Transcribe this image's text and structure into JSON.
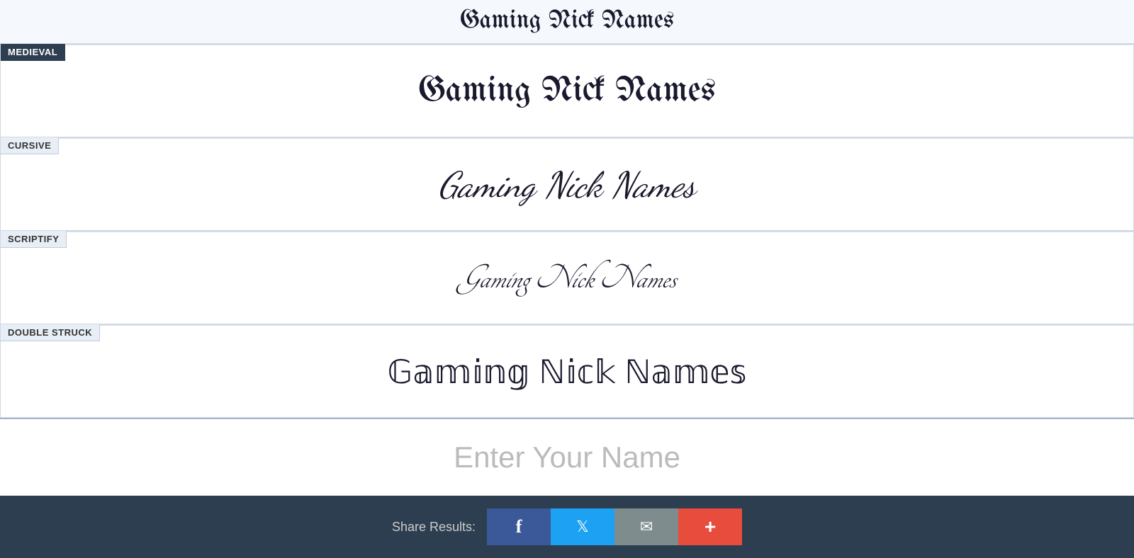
{
  "top": {
    "text": "Gaming Nick Names"
  },
  "sections": [
    {
      "id": "medieval",
      "label": "MEDIEVAL",
      "label_style": "dark",
      "text": "Gaming Nick Names",
      "font_class": "medieval-font"
    },
    {
      "id": "cursive",
      "label": "CURSIVE",
      "label_style": "light",
      "text": "Gaming Nick Names",
      "font_class": "cursive-font"
    },
    {
      "id": "scriptify",
      "label": "SCRIPTIFY",
      "label_style": "light",
      "text": "Gaming Nick Names",
      "font_class": "scriptify-font"
    },
    {
      "id": "double-struck",
      "label": "DOUBLE STRUCK",
      "label_style": "light",
      "text": "𝔾𝕒𝕞𝕚𝕟𝕘 ℕ𝕚𝕔𝕜 ℕ𝕒𝕞𝕖𝕤",
      "font_class": "double-struck-text"
    }
  ],
  "input": {
    "placeholder": "Enter Your Name",
    "value": ""
  },
  "share": {
    "label": "Share Results:",
    "buttons": [
      {
        "id": "facebook",
        "icon": "f",
        "class": "facebook",
        "aria": "Share on Facebook"
      },
      {
        "id": "twitter",
        "icon": "🐦",
        "class": "twitter",
        "aria": "Share on Twitter"
      },
      {
        "id": "email",
        "icon": "✉",
        "class": "email",
        "aria": "Share via Email"
      },
      {
        "id": "more",
        "icon": "+",
        "class": "more",
        "aria": "More sharing options"
      }
    ]
  }
}
